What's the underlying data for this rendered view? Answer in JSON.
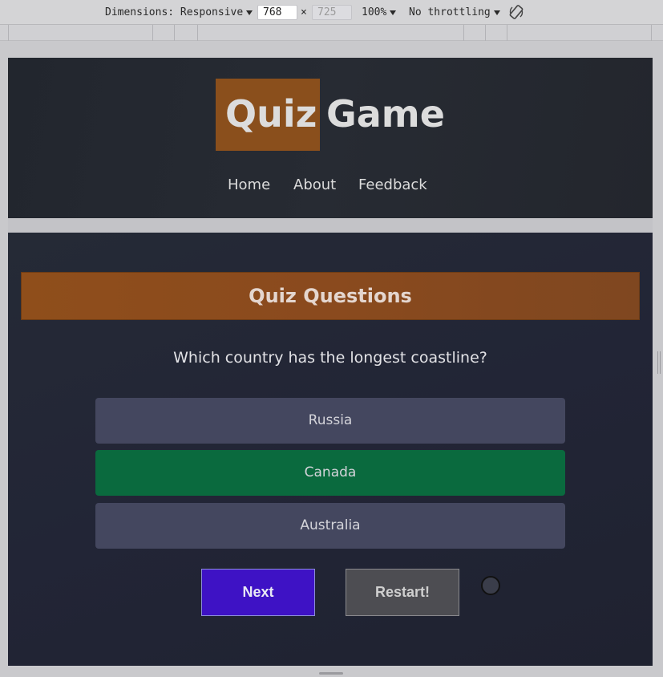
{
  "devtools": {
    "dimensions_label": "Dimensions: Responsive",
    "width_value": "768",
    "times": "×",
    "height_value": "725",
    "zoom": "100%",
    "throttling": "No throttling",
    "rotate_icon": "rotate-icon"
  },
  "site": {
    "logo_part1": "Quiz",
    "logo_part2": "Game",
    "nav": [
      {
        "label": "Home"
      },
      {
        "label": "About"
      },
      {
        "label": "Feedback"
      }
    ]
  },
  "quiz": {
    "heading": "Quiz Questions",
    "question": "Which country has the longest coastline?",
    "answers": [
      {
        "label": "Russia",
        "state": "neutral"
      },
      {
        "label": "Canada",
        "state": "correct"
      },
      {
        "label": "Australia",
        "state": "neutral"
      }
    ],
    "next_label": "Next",
    "restart_label": "Restart!"
  },
  "colors": {
    "accent_orange": "#8a4f1c",
    "correct_green": "#0a6a3e",
    "next_purple": "#3e12c5",
    "panel_dark": "#23262d"
  }
}
